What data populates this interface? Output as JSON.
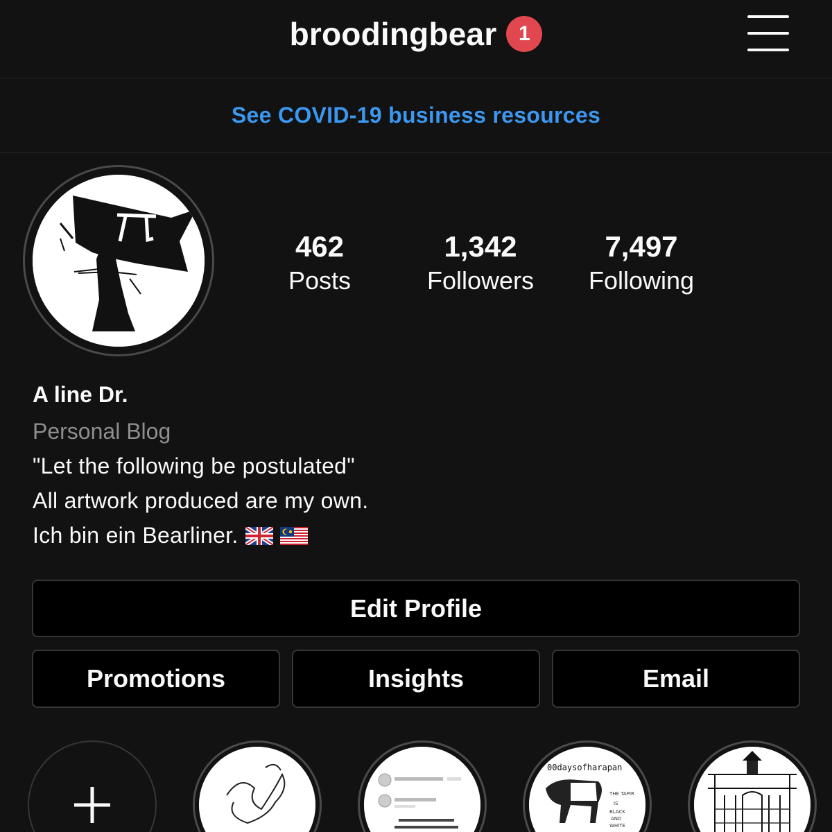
{
  "header": {
    "username": "broodingbear",
    "notification_count": "1"
  },
  "banner": {
    "link_text": "See COVID-19 business resources"
  },
  "stats": [
    {
      "value": "462",
      "label": "Posts"
    },
    {
      "value": "1,342",
      "label": "Followers"
    },
    {
      "value": "7,497",
      "label": "Following"
    }
  ],
  "bio": {
    "name": "A line Dr.",
    "category": "Personal Blog",
    "lines": [
      "\"Let the following be postulated\"",
      "All artwork produced are my own.",
      "Ich bin ein Bearliner."
    ],
    "flags": [
      "uk-flag-icon",
      "malaysia-flag-icon"
    ]
  },
  "buttons": {
    "edit_profile": "Edit Profile",
    "promotions": "Promotions",
    "insights": "Insights",
    "email": "Email"
  },
  "highlights": [
    {
      "icon": "plus-icon"
    },
    {
      "thumbnail": "ink-sketch"
    },
    {
      "thumbnail": "notifications-screenshot"
    },
    {
      "thumbnail": "100daysofharapan",
      "caption": "00daysofharapan"
    },
    {
      "thumbnail": "building-sketch"
    }
  ],
  "colors": {
    "background": "#121212",
    "accent_link": "#3b97f0",
    "badge": "#e0474f",
    "button_bg": "#000000",
    "button_border": "#363636",
    "secondary_text": "#8e8e8e"
  }
}
